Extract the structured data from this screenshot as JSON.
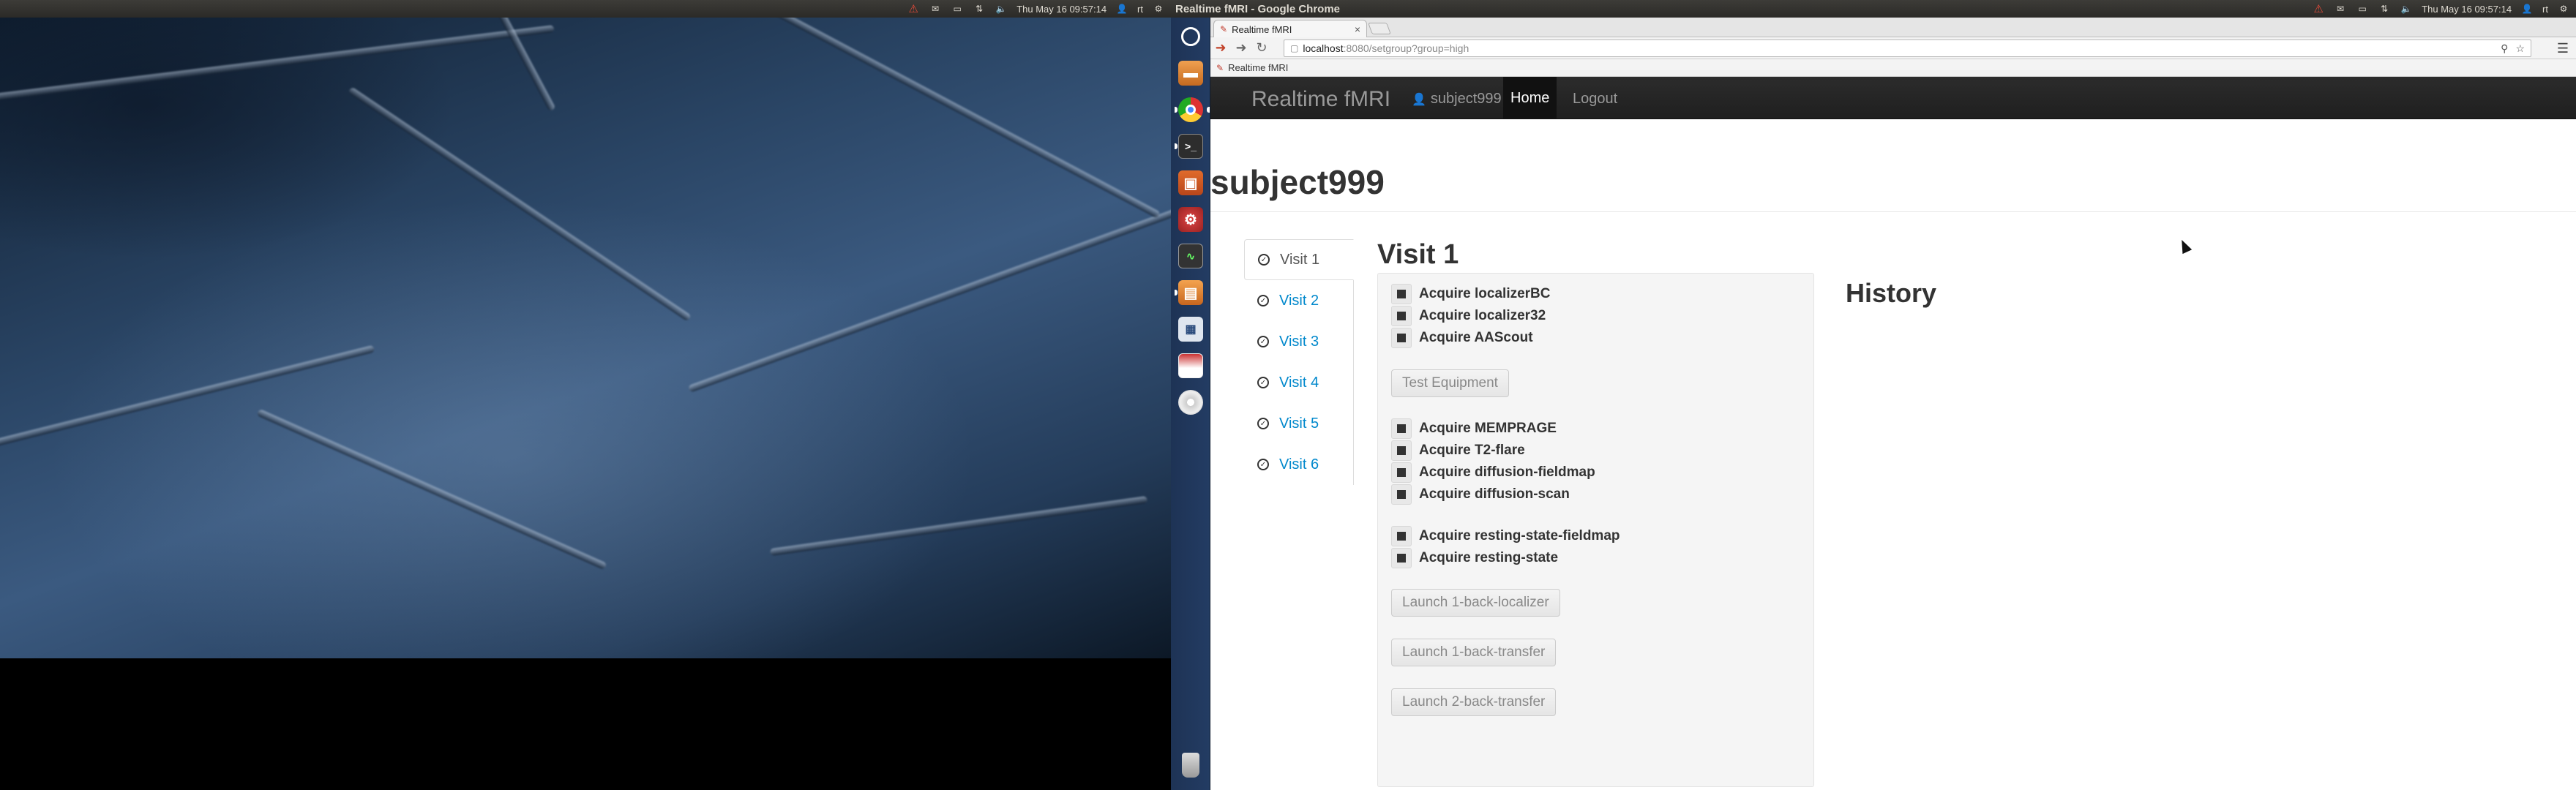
{
  "left_panel": {
    "datetime": "Thu May 16 09:57:14",
    "user": "rt"
  },
  "right_panel": {
    "window_title": "Realtime fMRI - Google Chrome",
    "datetime": "Thu May 16 09:57:14",
    "user": "rt"
  },
  "launcher": {
    "items": [
      "dash-icon",
      "files-icon",
      "chrome-icon",
      "terminal-icon",
      "software-center-icon",
      "settings-icon",
      "system-monitor-icon",
      "archive-icon",
      "remote-desktop-icon",
      "presentation-icon",
      "dvd-icon",
      "trash-icon"
    ]
  },
  "browser": {
    "tab_title": "Realtime fMRI",
    "url_host": "localhost",
    "url_path": ":8080/setgroup?group=high",
    "bookmark": "Realtime fMRI"
  },
  "navbar": {
    "brand": "Realtime fMRI",
    "user": "subject999",
    "home": "Home",
    "logout": "Logout"
  },
  "page": {
    "subject": "subject999",
    "visit_title": "Visit 1",
    "history_title": "History"
  },
  "visits": [
    "Visit 1",
    "Visit 2",
    "Visit 3",
    "Visit 4",
    "Visit 5",
    "Visit 6"
  ],
  "steps": {
    "group1": [
      "Acquire localizerBC",
      "Acquire localizer32",
      "Acquire AAScout"
    ],
    "test_equipment": "Test Equipment",
    "group2": [
      "Acquire MEMPRAGE",
      "Acquire T2-flare",
      "Acquire diffusion-fieldmap",
      "Acquire diffusion-scan"
    ],
    "group3": [
      "Acquire resting-state-fieldmap",
      "Acquire resting-state"
    ],
    "launch_buttons": [
      "Launch 1-back-localizer",
      "Launch 1-back-transfer",
      "Launch 2-back-transfer"
    ]
  },
  "colors": {
    "link": "#0088cc",
    "navbar": "#222222",
    "warning": "#e84b3a"
  }
}
